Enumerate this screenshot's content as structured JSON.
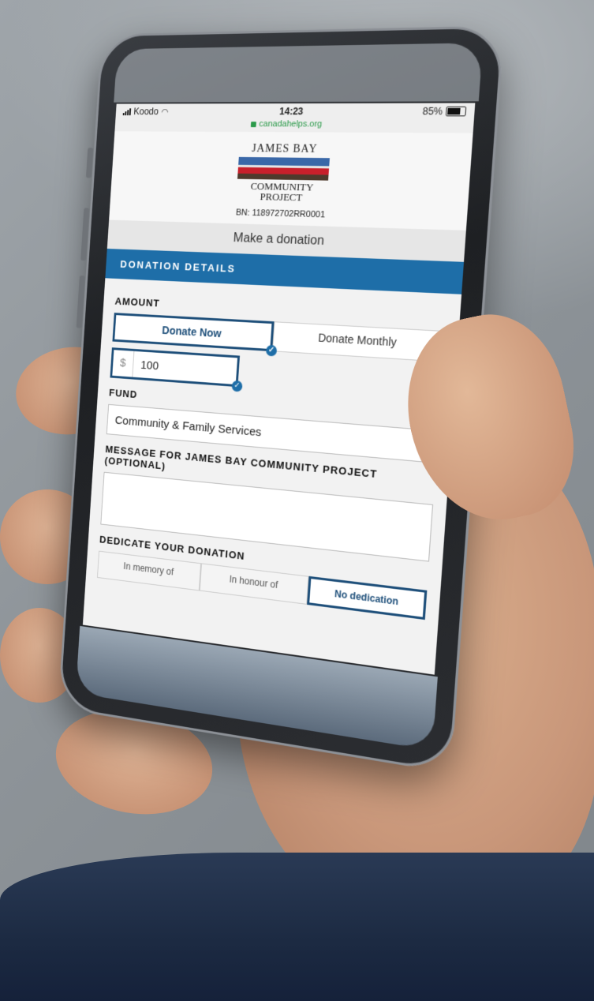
{
  "status_bar": {
    "carrier": "Koodo",
    "time": "14:23",
    "battery": "85%",
    "battery_level": 0.85,
    "url": "canadahelps.org"
  },
  "org": {
    "logo_top": "JAMES BAY",
    "logo_bottom_1": "COMMUNITY",
    "logo_bottom_2": "PROJECT",
    "bn": "BN: 118972702RR0001"
  },
  "page": {
    "title": "Make a donation",
    "section": "DONATION DETAILS"
  },
  "amount": {
    "label": "AMOUNT",
    "donate_now": "Donate Now",
    "donate_monthly": "Donate Monthly",
    "currency": "$",
    "value": "100"
  },
  "fund": {
    "label": "FUND",
    "selected": "Community & Family Services"
  },
  "message": {
    "label": "MESSAGE FOR JAMES BAY COMMUNITY PROJECT (OPTIONAL)",
    "value": ""
  },
  "dedicate": {
    "label": "DEDICATE YOUR DONATION",
    "options": [
      "In memory of",
      "In honour of",
      "No dedication"
    ]
  },
  "colors": {
    "primary": "#1e6ea8",
    "selected_border": "#1e4f7a",
    "url_green": "#2b9a4a"
  }
}
